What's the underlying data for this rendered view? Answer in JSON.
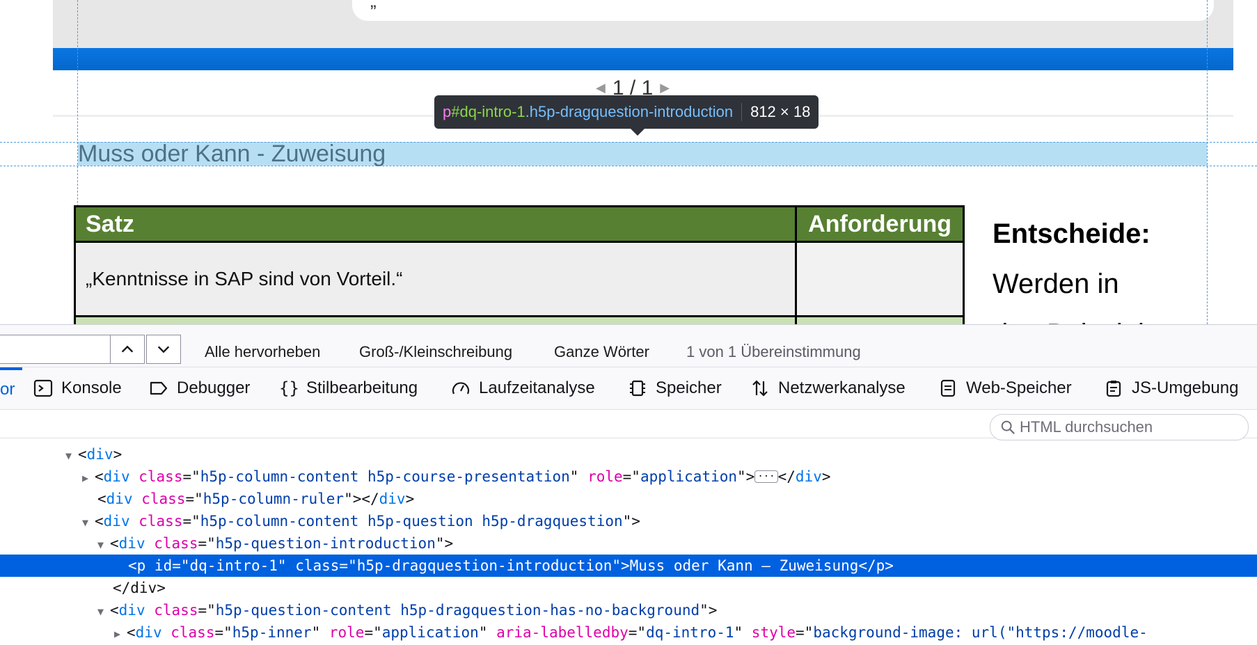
{
  "page": {
    "answer_snippet": "„                              “",
    "pager": {
      "current": "1",
      "separator": "/",
      "total": "1"
    },
    "intro_text": "Muss oder Kann - Zuweisung",
    "tooltip": {
      "tag": "p",
      "id": "#dq-intro-1",
      "class": ".h5p-dragquestion-introduction",
      "size": "812 × 18"
    },
    "table": {
      "headers": [
        "Satz",
        "Anforderung"
      ],
      "row1": "„Kenntnisse in SAP sind von Vorteil.“"
    },
    "side": {
      "heading": "Entscheide:",
      "line1": "Werden in",
      "line2": "den Beispiel"
    }
  },
  "findbar": {
    "highlight_all": "Alle hervorheben",
    "match_case": "Groß-/Kleinschreibung",
    "whole_words": "Ganze Wörter",
    "count": "1 von 1 Übereinstimmung"
  },
  "tabs": {
    "inspector_partial": "or",
    "items": [
      "Konsole",
      "Debugger",
      "Stilbearbeitung",
      "Laufzeitanalyse",
      "Speicher",
      "Netzwerkanalyse",
      "Web-Speicher",
      "JS-Umgebung"
    ]
  },
  "html_search": {
    "placeholder": "HTML durchsuchen"
  },
  "markup": {
    "l1": {
      "tag": "div"
    },
    "l2": {
      "tag": "div",
      "a1n": "class",
      "a1v": "h5p-column-content h5p-course-presentation",
      "a2n": "role",
      "a2v": "application"
    },
    "l3": {
      "tag": "div",
      "a1n": "class",
      "a1v": "h5p-column-ruler"
    },
    "l4": {
      "tag": "div",
      "a1n": "class",
      "a1v": "h5p-column-content h5p-question h5p-dragquestion"
    },
    "l5": {
      "tag": "div",
      "a1n": "class",
      "a1v": "h5p-question-introduction"
    },
    "l6": {
      "text": "<p id=\"dq-intro-1\" class=\"h5p-dragquestion-introduction\">Muss oder Kann – Zuweisung</p>"
    },
    "l7": {
      "text": "</div>"
    },
    "l8": {
      "tag": "div",
      "a1n": "class",
      "a1v": "h5p-question-content h5p-dragquestion-has-no-background"
    },
    "l9": {
      "tag": "div",
      "a1n": "class",
      "a1v": "h5p-inner",
      "a2n": "role",
      "a2v": "application",
      "a3n": "aria-labelledby",
      "a3v": "dq-intro-1",
      "a4n": "style",
      "a4v": "background-image: url(\"https://moodle-"
    }
  }
}
